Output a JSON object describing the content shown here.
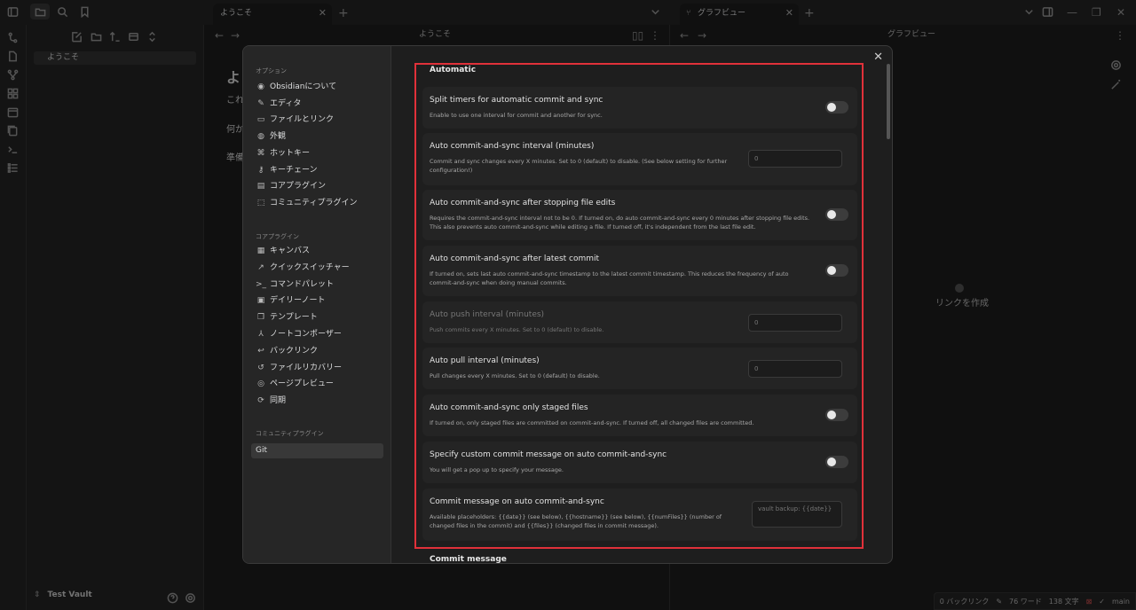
{
  "tabs": {
    "left": "ようこそ",
    "right": "グラフビュー"
  },
  "pane_headers": {
    "left": "ようこそ",
    "right": "グラフビュー"
  },
  "sidebar": {
    "file": "ようこそ",
    "vault": "Test Vault"
  },
  "note": {
    "title_char": "よ",
    "line1": "これ",
    "line2": "何か",
    "line3": "準備"
  },
  "graph": {
    "node_label": "リンクを作成"
  },
  "statusbar": {
    "backlinks": "0 バックリンク",
    "words": "76 ワード",
    "chars": "138 文字",
    "branch": "main"
  },
  "settings_nav": {
    "sections": {
      "options": "オプション",
      "core": "コアプラグイン",
      "community": "コミュニティプラグイン"
    },
    "options_items": [
      {
        "label": "Obsidianについて",
        "icon": "◉"
      },
      {
        "label": "エディタ",
        "icon": "✎"
      },
      {
        "label": "ファイルとリンク",
        "icon": "▭"
      },
      {
        "label": "外観",
        "icon": "◍"
      },
      {
        "label": "ホットキー",
        "icon": "⌘"
      },
      {
        "label": "キーチェーン",
        "icon": "⚷"
      },
      {
        "label": "コアプラグイン",
        "icon": "▤"
      },
      {
        "label": "コミュニティプラグイン",
        "icon": "⬚"
      }
    ],
    "core_items": [
      {
        "label": "キャンバス",
        "icon": "▦"
      },
      {
        "label": "クイックスイッチャー",
        "icon": "↗"
      },
      {
        "label": "コマンドパレット",
        "icon": ">_"
      },
      {
        "label": "デイリーノート",
        "icon": "▣"
      },
      {
        "label": "テンプレート",
        "icon": "❐"
      },
      {
        "label": "ノートコンポーザー",
        "icon": "⅄"
      },
      {
        "label": "バックリンク",
        "icon": "↩"
      },
      {
        "label": "ファイルリカバリー",
        "icon": "↺"
      },
      {
        "label": "ページプレビュー",
        "icon": "◎"
      },
      {
        "label": "同期",
        "icon": "⟳"
      }
    ],
    "community_items": [
      {
        "label": "Git"
      }
    ]
  },
  "settings": {
    "section_heading": "Automatic",
    "next_heading": "Commit message",
    "items": [
      {
        "name": "Split timers for automatic commit and sync",
        "desc": "Enable to use one interval for commit and another for sync."
      },
      {
        "name": "Auto commit-and-sync interval (minutes)",
        "desc": "Commit and sync changes every X minutes. Set to 0 (default) to disable. (See below setting for further configuration!)",
        "value": "0"
      },
      {
        "name": "Auto commit-and-sync after stopping file edits",
        "desc": "Requires the commit-and-sync interval not to be 0. If turned on, do auto commit-and-sync every 0 minutes after stopping file edits. This also prevents auto commit-and-sync while editing a file. If turned off, it's independent from the last file edit."
      },
      {
        "name": "Auto commit-and-sync after latest commit",
        "desc": "If turned on, sets last auto commit-and-sync timestamp to the latest commit timestamp. This reduces the frequency of auto commit-and-sync when doing manual commits."
      },
      {
        "name": "Auto push interval (minutes)",
        "desc": "Push commits every X minutes. Set to 0 (default) to disable.",
        "value": "0"
      },
      {
        "name": "Auto pull interval (minutes)",
        "desc": "Pull changes every X minutes. Set to 0 (default) to disable.",
        "value": "0"
      },
      {
        "name": "Auto commit-and-sync only staged files",
        "desc": "If turned on, only staged files are committed on commit-and-sync. If turned off, all changed files are committed."
      },
      {
        "name": "Specify custom commit message on auto commit-and-sync",
        "desc": "You will get a pop up to specify your message."
      },
      {
        "name": "Commit message on auto commit-and-sync",
        "desc": "Available placeholders: {{date}} (see below), {{hostname}} (see below), {{numFiles}} (number of changed files in the commit) and {{files}} (changed files in commit message).",
        "placeholder": "vault backup: {{date}}"
      }
    ]
  },
  "icons": {
    "sidebar_toggle": "sidebar-toggle-icon",
    "folder": "folder-icon",
    "search": "search-icon",
    "bookmark": "bookmark-icon",
    "close": "close-icon",
    "gear": "gear-icon"
  }
}
